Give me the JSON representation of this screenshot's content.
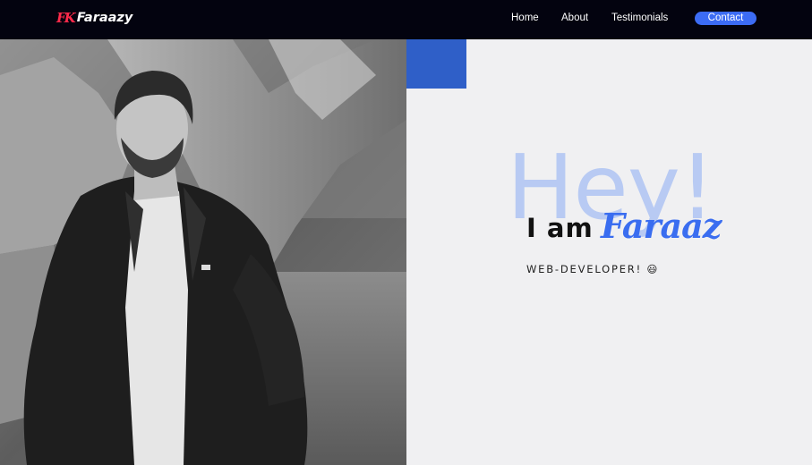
{
  "brand": {
    "mark": "FK",
    "name": "Faraazy"
  },
  "nav": {
    "home": "Home",
    "about": "About",
    "testimonials": "Testimonials",
    "contact": "Contact"
  },
  "hero": {
    "watermark": "Hey!",
    "intro": "I am",
    "name": "Faraaz",
    "role": "WEB-DEVELOPER! 😃"
  },
  "colors": {
    "navbar": "#03030f",
    "accent": "#3c6cf4",
    "accent_block": "#2f5fc8",
    "watermark": "#b8caf3",
    "name": "#3a6df0",
    "background": "#f0f0f2"
  },
  "photo": {
    "alt": "Black and white portrait of a man in a bomber jacket in front of a large tree trunk"
  }
}
